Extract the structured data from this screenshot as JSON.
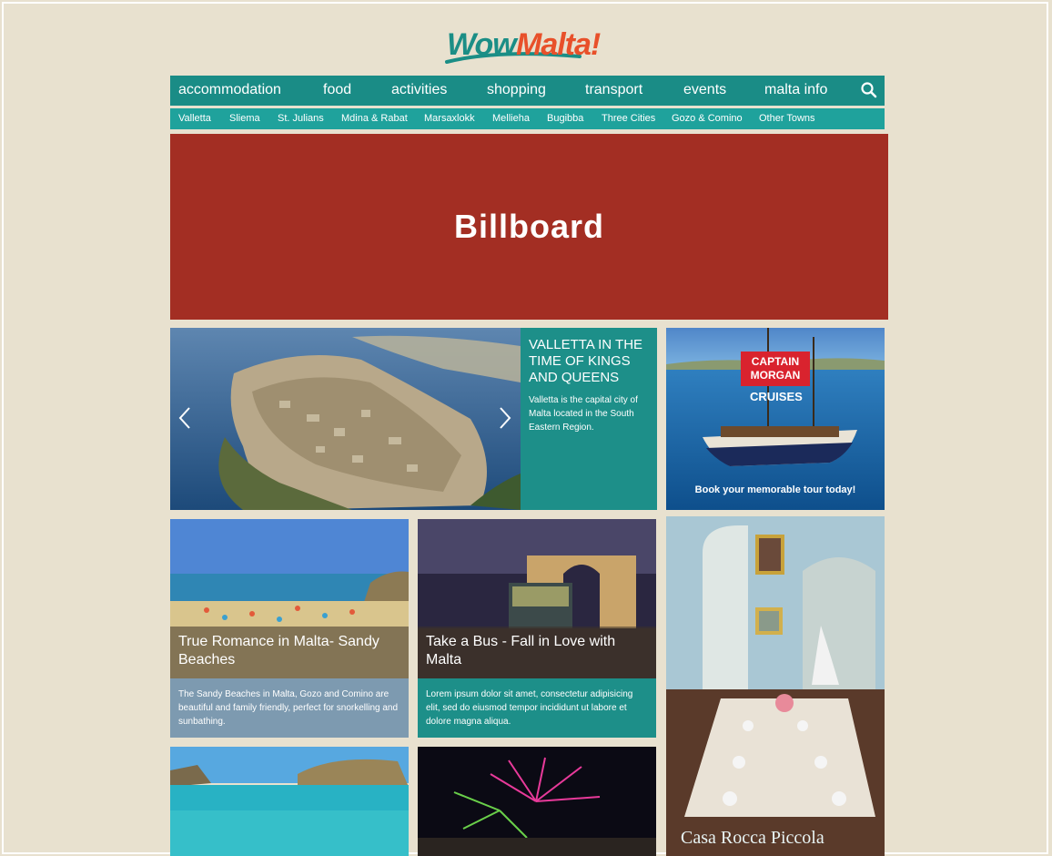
{
  "logo": {
    "part1": "Wow",
    "part2": "Malta!"
  },
  "nav_main": [
    {
      "label": "accommodation"
    },
    {
      "label": "food"
    },
    {
      "label": "activities"
    },
    {
      "label": "shopping"
    },
    {
      "label": "transport"
    },
    {
      "label": "events"
    },
    {
      "label": "malta info"
    }
  ],
  "nav_sub": [
    {
      "label": "Valletta"
    },
    {
      "label": "Sliema"
    },
    {
      "label": "St. Julians"
    },
    {
      "label": "Mdina & Rabat"
    },
    {
      "label": "Marsaxlokk"
    },
    {
      "label": "Mellieha"
    },
    {
      "label": "Bugibba"
    },
    {
      "label": "Three Cities"
    },
    {
      "label": "Gozo & Comino"
    },
    {
      "label": "Other Towns"
    }
  ],
  "billboard": {
    "label": "Billboard"
  },
  "hero": {
    "title": "VALLETTA IN THE TIME OF KINGS AND QUEENS",
    "description": "Valletta is the capital city of Malta located in the South Eastern Region.",
    "prev_icon": "chevron-left-icon",
    "next_icon": "chevron-right-icon"
  },
  "ad": {
    "brand": "CAPTAIN MORGAN",
    "sub": "CRUISES",
    "cta": "Book your memorable tour today!"
  },
  "cards": [
    {
      "title": "True Romance in Malta- Sandy Beaches",
      "description": "The Sandy Beaches in Malta, Gozo and Comino are beautiful and family friendly, perfect for snorkelling and sunbathing.",
      "color": "#7d9ab0"
    },
    {
      "title": "Take a Bus - Fall in Love with Malta",
      "description": "Lorem ipsum dolor sit amet, consectetur adipisicing elit, sed do eiusmod tempor incididunt ut labore et dolore magna aliqua.",
      "color": "#1d8f89"
    }
  ],
  "tall_card": {
    "caption": "Casa Rocca Piccola"
  },
  "colors": {
    "background": "#e8e1cf",
    "nav_main": "#1a8c86",
    "nav_sub": "#1fa29c",
    "billboard": "#a32e23",
    "accent_orange": "#e8502a"
  }
}
